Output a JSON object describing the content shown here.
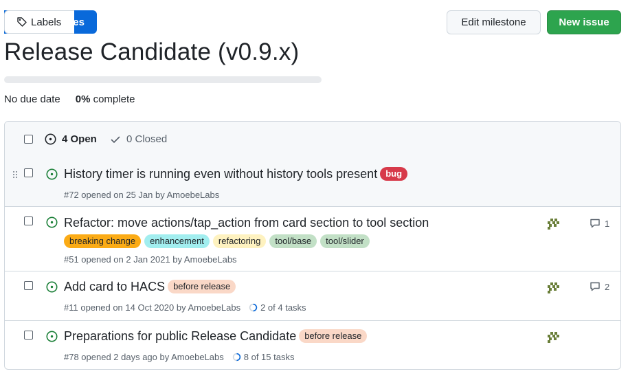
{
  "nav": {
    "labels_label": "Labels",
    "milestones_label": "Milestones"
  },
  "actions": {
    "edit_label": "Edit milestone",
    "new_issue_label": "New issue"
  },
  "milestone": {
    "title": "Release Candidate (v0.9.x)",
    "due": "No due date",
    "percent": "0%",
    "percent_suffix": "complete",
    "progress": 0
  },
  "list": {
    "open_label": "4 Open",
    "closed_label": "0 Closed",
    "issues": [
      {
        "title": "History timer is running even without history tools present",
        "labels": [
          {
            "text": "bug",
            "bg": "#d73a4a",
            "fg": "#ffffff"
          }
        ],
        "meta": "#72 opened on 25 Jan by AmoebeLabs"
      },
      {
        "title": "Refactor: move actions/tap_action from card section to tool section",
        "labels": [
          {
            "text": "breaking change",
            "bg": "#fbab16",
            "fg": "#1f2328"
          },
          {
            "text": "enhancement",
            "bg": "#a2eeef",
            "fg": "#1f2328"
          },
          {
            "text": "refactoring",
            "bg": "#fef2c0",
            "fg": "#1f2328"
          },
          {
            "text": "tool/base",
            "bg": "#c2e0c6",
            "fg": "#1f2328"
          },
          {
            "text": "tool/slider",
            "bg": "#c2e0c6",
            "fg": "#1f2328"
          }
        ],
        "meta": "#51 opened on 2 Jan 2021 by AmoebeLabs",
        "comments": "1"
      },
      {
        "title": "Add card to HACS",
        "labels": [
          {
            "text": "before release",
            "bg": "#fad8c7",
            "fg": "#1f2328"
          }
        ],
        "meta": "#11 opened on 14 Oct 2020 by AmoebeLabs",
        "tasks": "2 of 4 tasks",
        "comments": "2"
      },
      {
        "title": "Preparations for public Release Candidate",
        "labels": [
          {
            "text": "before release",
            "bg": "#fad8c7",
            "fg": "#1f2328"
          }
        ],
        "meta": "#78 opened 2 days ago by AmoebeLabs",
        "tasks": "8 of 15 tasks"
      }
    ]
  },
  "icons": {
    "tag": "tag-icon",
    "milestone": "milestone-signpost-icon",
    "issue_open": "issue-opened-icon",
    "check": "check-icon",
    "comment": "comment-icon",
    "progress": "task-progress-icon",
    "avatar": "identicon-avatar",
    "grip": "drag-handle-icon"
  },
  "colors": {
    "accent": "#0969da",
    "success": "#2da44e",
    "open": "#1a7f37",
    "border": "#d0d7de"
  }
}
